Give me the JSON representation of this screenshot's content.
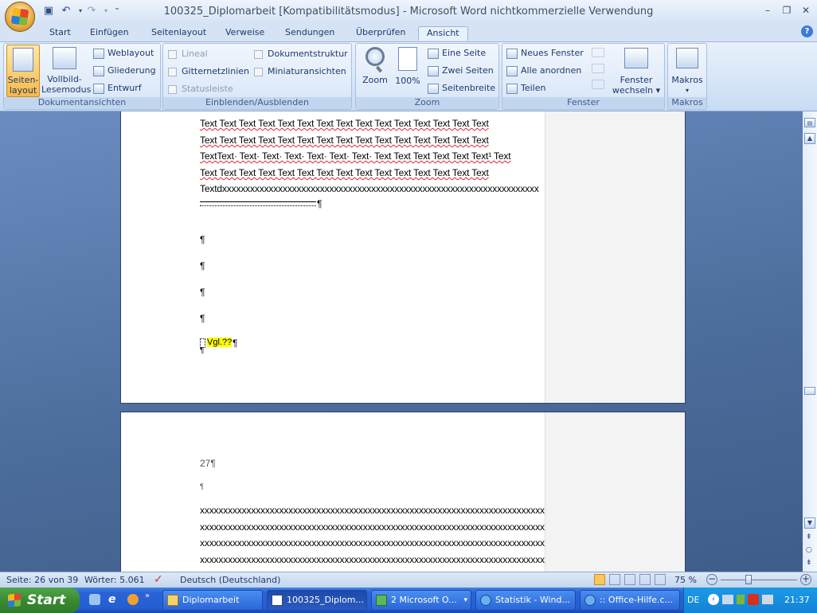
{
  "app": {
    "title": "100325_Diplomarbeit [Kompatibilitätsmodus] - Microsoft Word nichtkommerzielle Verwendung"
  },
  "quick_access": {
    "save_icon": "save-icon",
    "undo_icon": "undo-icon",
    "redo_icon": "redo-icon",
    "customize_icon": "customize-qat-icon"
  },
  "tabs": [
    "Start",
    "Einfügen",
    "Seitenlayout",
    "Verweise",
    "Sendungen",
    "Überprüfen",
    "Ansicht"
  ],
  "active_tab": "Ansicht",
  "ribbon": {
    "dokumentansichten": {
      "label": "Dokumentansichten",
      "seitenlayout": "Seiten-\nlayout",
      "seitenlayout_l1": "Seiten-",
      "seitenlayout_l2": "layout",
      "vollbild_l1": "Vollbild-",
      "vollbild_l2": "Lesemodus",
      "weblayout": "Weblayout",
      "gliederung": "Gliederung",
      "entwurf": "Entwurf"
    },
    "einblenden": {
      "label": "Einblenden/Ausblenden",
      "lineal": "Lineal",
      "gitternetzlinien": "Gitternetzlinien",
      "statusleiste": "Statusleiste",
      "dokumentstruktur": "Dokumentstruktur",
      "miniaturansichten": "Miniaturansichten"
    },
    "zoom": {
      "label": "Zoom",
      "zoom": "Zoom",
      "hundred": "100%",
      "eine_seite": "Eine Seite",
      "zwei_seiten": "Zwei Seiten",
      "seitenbreite": "Seitenbreite"
    },
    "fenster": {
      "label": "Fenster",
      "neues_fenster": "Neues Fenster",
      "alle_anordnen": "Alle anordnen",
      "teilen": "Teilen",
      "wechseln_l1": "Fenster",
      "wechseln_l2": "wechseln ▾"
    },
    "makros": {
      "label": "Makros",
      "makros": "Makros"
    }
  },
  "document": {
    "page1_lines": [
      "Text Text Text Text Text Text Text Text Text Text Text Text Text Text Text",
      "Text Text Text Text Text Text Text Text Text Text Text Text Text Text Text",
      "TextText· Text· Text· Text· Text· Text· Text· Text Text Text Text Text Text¹ Text",
      "Text Text Text Text Text Text Text Text Text Text Text Text Text Text Text",
      "Textdxxxxxxxxxxxxxxxxxxxxxxxxxxxxxxxxxxxxxxxxxxxxxxxxxxxxxxxxxxxxxxxxxxxx"
    ],
    "pilcrow": "¶",
    "vgl_text": "Vgl.??",
    "page2_number": "27¶",
    "page2_small_pilcrow": "¶",
    "page2_lines": [
      "xxxxxxxxxxxxxxxxxxxxxxxxxxxxxxxxxxxxxxxxxxxxxxxxxxxxxxxxxxxxxxxxxxxxxxxxxx",
      "xxxxxxxxxxxxxxxxxxxxxxxxxxxxxxxxxxxxxxxxxxxxxxxxxxxxxxxxxxxxxxxxxxxxxxxxxx",
      "xxxxxxxxxxxxxxxxxxxxxxxxxxxxxxxxxxxxxxxxxxxxxxxxxxxxxxxxxxxxxxxxxxxxxxxxxx",
      "xxxxxxxxxxxxxxxxxxxxxxxxxxxxxxxxxxxxxxxxxxxxxxxxxxxxxxxxxxxxxxxxxxxxxxxxxx"
    ]
  },
  "statusbar": {
    "page": "Seite: 26 von 39",
    "words": "Wörter: 5.061",
    "language": "Deutsch (Deutschland)",
    "zoom": "75 %",
    "zoom_level": 75
  },
  "taskbar": {
    "start": "Start",
    "items": [
      {
        "label": "Diplomarbeit",
        "icon": "folder-icon"
      },
      {
        "label": "100325_Diplom...",
        "icon": "word-icon",
        "active": true
      },
      {
        "label": "2 Microsoft O...",
        "icon": "excel-icon"
      },
      {
        "label": "Statistik - Wind...",
        "icon": "ie-icon"
      },
      {
        "label": ":: Office-Hilfe.c...",
        "icon": "ie-icon"
      }
    ],
    "lang": "DE",
    "clock": "21:37"
  },
  "colors": {
    "highlight": "#ffff00",
    "ribbon_bg": "#d6e5f7",
    "taskbar": "#245fd2",
    "start_green": "#3b8a33"
  }
}
